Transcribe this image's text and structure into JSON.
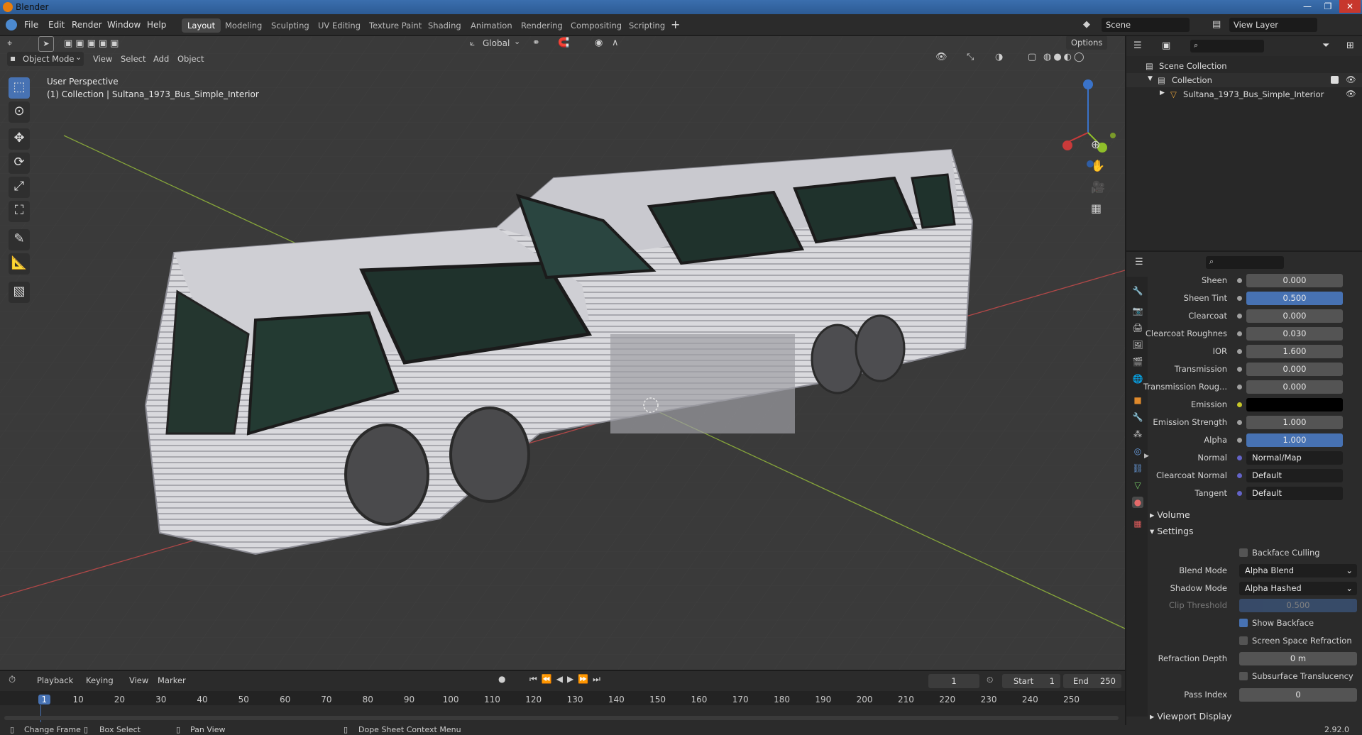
{
  "window": {
    "title": "Blender"
  },
  "menu": [
    "File",
    "Edit",
    "Render",
    "Window",
    "Help"
  ],
  "workspaces": [
    "Layout",
    "Modeling",
    "Sculpting",
    "UV Editing",
    "Texture Paint",
    "Shading",
    "Animation",
    "Rendering",
    "Compositing",
    "Scripting"
  ],
  "scene": {
    "name": "Scene",
    "view_layer": "View Layer"
  },
  "viewport": {
    "mode": "Object Mode",
    "menus": [
      "View",
      "Select",
      "Add",
      "Object"
    ],
    "orientation": "Global",
    "options": "Options",
    "perspective": "User Perspective",
    "collection_info": "(1) Collection | Sultana_1973_Bus_Simple_Interior"
  },
  "outliner": {
    "scene_collection": "Scene Collection",
    "collection": "Collection",
    "object": "Sultana_1973_Bus_Simple_Interior"
  },
  "properties": {
    "rows": [
      {
        "label": "Sheen",
        "value": "0.000",
        "style": "normal"
      },
      {
        "label": "Sheen Tint",
        "value": "0.500",
        "style": "blue"
      },
      {
        "label": "Clearcoat",
        "value": "0.000",
        "style": "normal"
      },
      {
        "label": "Clearcoat Roughnes",
        "value": "0.030",
        "style": "normal"
      },
      {
        "label": "IOR",
        "value": "1.600",
        "style": "normal"
      },
      {
        "label": "Transmission",
        "value": "0.000",
        "style": "normal"
      },
      {
        "label": "Transmission Roug...",
        "value": "0.000",
        "style": "normal"
      },
      {
        "label": "Emission",
        "value": "",
        "style": "black"
      },
      {
        "label": "Emission Strength",
        "value": "1.000",
        "style": "normal"
      },
      {
        "label": "Alpha",
        "value": "1.000",
        "style": "blue"
      },
      {
        "label": "Normal",
        "value": "Normal/Map",
        "style": "dark"
      },
      {
        "label": "Clearcoat Normal",
        "value": "Default",
        "style": "dark"
      },
      {
        "label": "Tangent",
        "value": "Default",
        "style": "dark"
      }
    ],
    "volume": "Volume",
    "settings": "Settings",
    "backface_culling": "Backface Culling",
    "blend_mode_label": "Blend Mode",
    "blend_mode": "Alpha Blend",
    "shadow_mode_label": "Shadow Mode",
    "shadow_mode": "Alpha Hashed",
    "clip_threshold_label": "Clip Threshold",
    "clip_threshold": "0.500",
    "show_backface": "Show Backface",
    "screen_space_refraction": "Screen Space Refraction",
    "refraction_depth_label": "Refraction Depth",
    "refraction_depth": "0 m",
    "subsurface_translucency": "Subsurface Translucency",
    "pass_index_label": "Pass Index",
    "pass_index": "0",
    "viewport_display": "Viewport Display"
  },
  "timeline": {
    "menus": [
      "Playback",
      "Keying",
      "View",
      "Marker"
    ],
    "current_frame": "1",
    "start_label": "Start",
    "start": "1",
    "end_label": "End",
    "end": "250",
    "ticks": [
      "1",
      "10",
      "20",
      "30",
      "40",
      "50",
      "60",
      "70",
      "80",
      "90",
      "100",
      "110",
      "120",
      "130",
      "140",
      "150",
      "160",
      "170",
      "180",
      "190",
      "200",
      "210",
      "220",
      "230",
      "240",
      "250"
    ]
  },
  "statusbar": {
    "change_frame": "Change Frame",
    "box_select": "Box Select",
    "pan_view": "Pan View",
    "context_menu": "Dope Sheet Context Menu",
    "version": "2.92.0"
  },
  "colors": {
    "accent": "#4772b3",
    "grid_x": "#c44a4a",
    "grid_y": "#8aa13a"
  }
}
